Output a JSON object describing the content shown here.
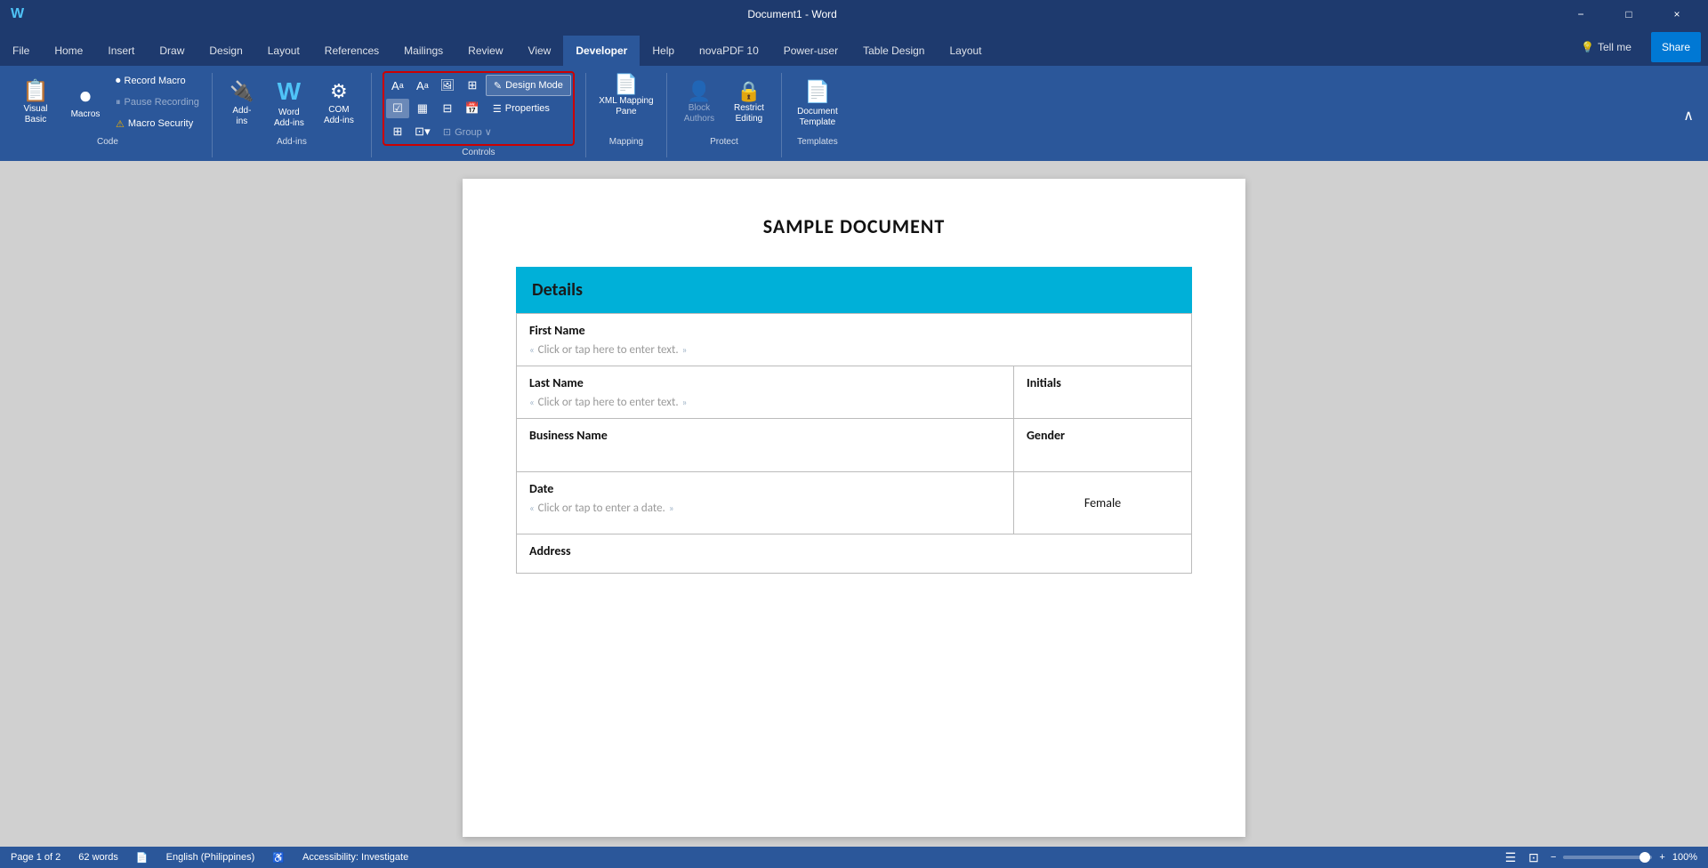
{
  "titlebar": {
    "title": "Document1 - Word",
    "minimize": "−",
    "maximize": "□",
    "close": "×"
  },
  "tabs": [
    {
      "label": "File",
      "active": false
    },
    {
      "label": "Home",
      "active": false
    },
    {
      "label": "Insert",
      "active": false
    },
    {
      "label": "Draw",
      "active": false
    },
    {
      "label": "Design",
      "active": false
    },
    {
      "label": "Layout",
      "active": false
    },
    {
      "label": "References",
      "active": false
    },
    {
      "label": "Mailings",
      "active": false
    },
    {
      "label": "Review",
      "active": false
    },
    {
      "label": "View",
      "active": false
    },
    {
      "label": "Developer",
      "active": true
    },
    {
      "label": "Help",
      "active": false
    },
    {
      "label": "novaPDF 10",
      "active": false
    },
    {
      "label": "Power-user",
      "active": false
    },
    {
      "label": "Table Design",
      "active": false
    },
    {
      "label": "Layout",
      "active": false
    }
  ],
  "ribbon": {
    "groups": {
      "code": {
        "label": "Code",
        "visual_basic": "Visual\nBasic",
        "macros": "Macros",
        "record_macro": "Record Macro",
        "pause_recording": "Pause Recording",
        "macro_security": "Macro Security"
      },
      "addins": {
        "label": "Add-ins",
        "add_ins": "Add-\nins",
        "word_add_ins": "Word\nAdd-ins",
        "com_add_ins": "COM\nAdd-ins"
      },
      "controls": {
        "label": "Controls",
        "design_mode": "Design Mode",
        "properties": "Properties",
        "group": "Group ∨"
      },
      "mapping": {
        "label": "Mapping",
        "xml_mapping_pane": "XML Mapping\nPane"
      },
      "protect": {
        "label": "Protect",
        "block_authors": "Block\nAuthors",
        "restrict_editing": "Restrict\nEditing"
      },
      "templates": {
        "label": "Templates",
        "document_template": "Document\nTemplate"
      }
    },
    "collapse_icon": "∧"
  },
  "document": {
    "title": "SAMPLE DOCUMENT",
    "details_header": "Details",
    "fields": {
      "first_name": "First Name",
      "first_name_placeholder": "Click or tap here to enter text.",
      "last_name": "Last Name",
      "last_name_placeholder": "Click or tap here to enter text.",
      "initials": "Initials",
      "business_name": "Business Name",
      "gender": "Gender",
      "date": "Date",
      "date_placeholder": "Click or tap to enter a date.",
      "female": "Female",
      "address": "Address"
    }
  },
  "status": {
    "page": "Page 1 of 2",
    "words": "62 words",
    "language": "English (Philippines)",
    "accessibility": "Accessibility: Investigate",
    "zoom": "100%",
    "zoom_minus": "−",
    "zoom_plus": "+"
  },
  "tell_me": "Tell me",
  "share": "Share"
}
